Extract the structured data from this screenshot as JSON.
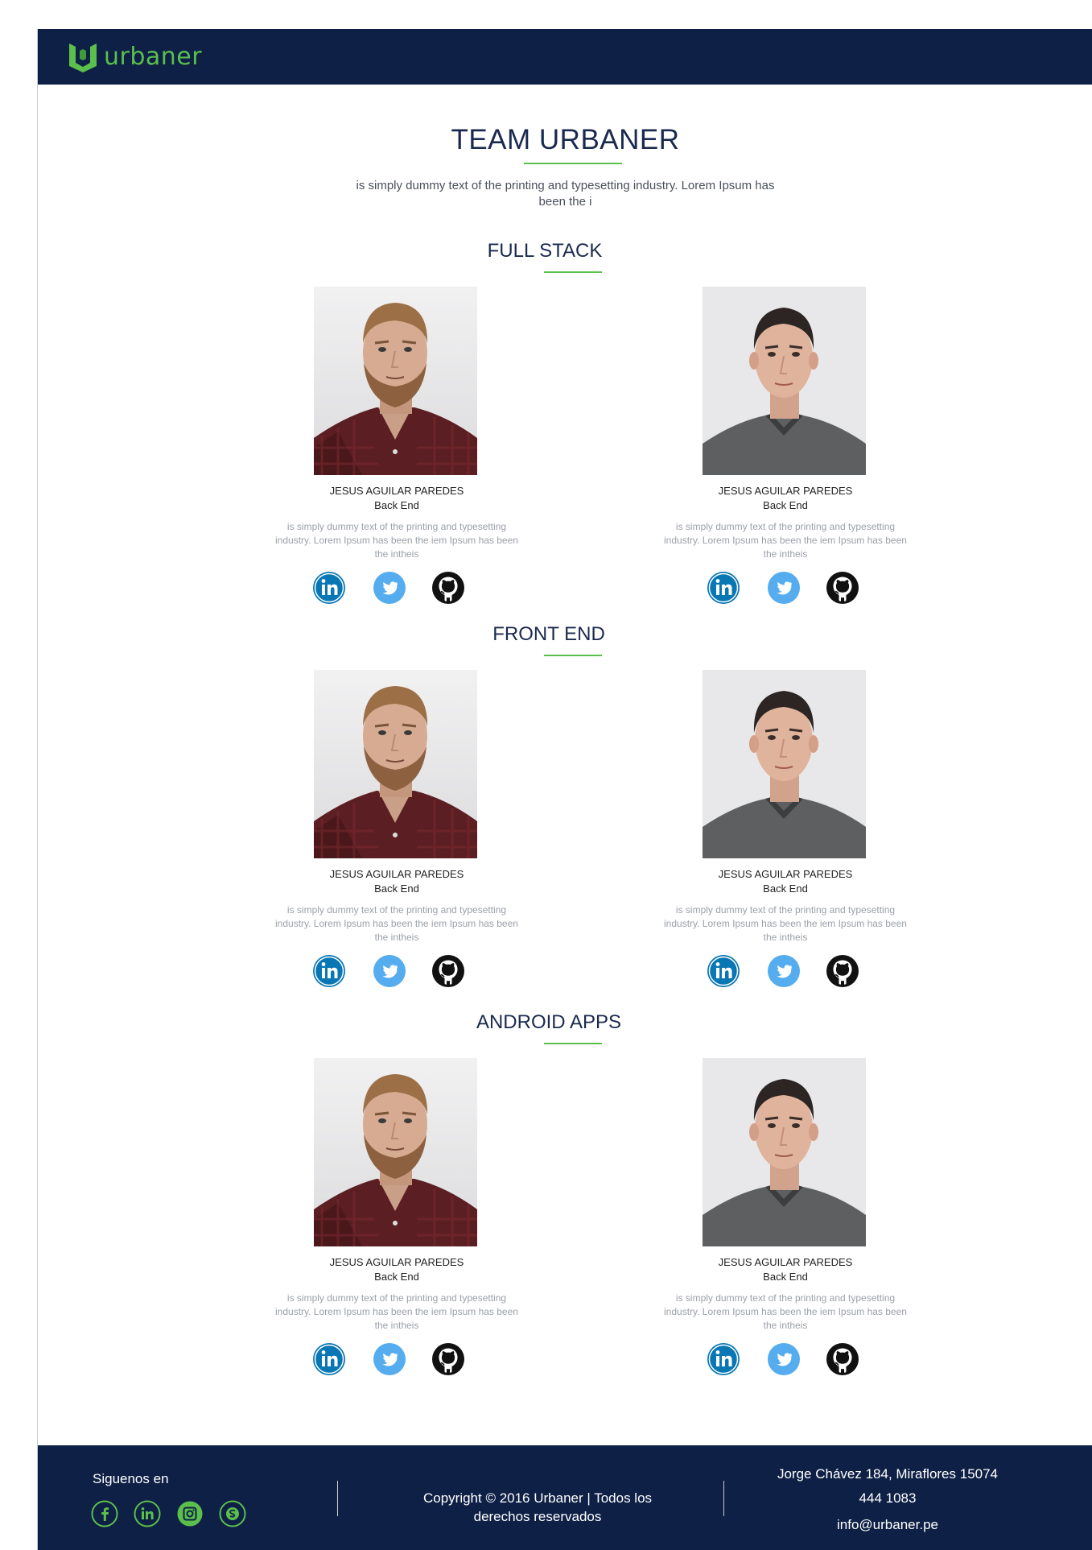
{
  "header": {
    "brand": "urbaner"
  },
  "page": {
    "title": "TEAM URBANER",
    "intro": "is simply dummy text of the printing and typesetting industry. Lorem Ipsum has been the i"
  },
  "sections": [
    {
      "title": "FULL STACK",
      "members": [
        {
          "name": "JESUS AGUILAR PAREDES",
          "role": "Back End",
          "description": "is simply dummy text of the printing and typesetting industry. Lorem Ipsum has been the iem Ipsum has been the intheis"
        },
        {
          "name": "JESUS AGUILAR PAREDES",
          "role": "Back End",
          "description": "is simply dummy text of the printing and typesetting industry. Lorem Ipsum has been the iem Ipsum has been the intheis"
        }
      ]
    },
    {
      "title": "FRONT END",
      "members": [
        {
          "name": "JESUS AGUILAR PAREDES",
          "role": "Back End",
          "description": "is simply dummy text of the printing and typesetting industry. Lorem Ipsum has been the iem Ipsum has been the intheis"
        },
        {
          "name": "JESUS AGUILAR PAREDES",
          "role": "Back End",
          "description": "is simply dummy text of the printing and typesetting industry. Lorem Ipsum has been the iem Ipsum has been the intheis"
        }
      ]
    },
    {
      "title": "ANDROID APPS",
      "members": [
        {
          "name": "JESUS AGUILAR PAREDES",
          "role": "Back End",
          "description": "is simply dummy text of the printing and typesetting industry. Lorem Ipsum has been the iem Ipsum has been the intheis"
        },
        {
          "name": "JESUS AGUILAR PAREDES",
          "role": "Back End",
          "description": "is simply dummy text of the printing and typesetting industry. Lorem Ipsum has been the iem Ipsum has been the intheis"
        }
      ]
    }
  ],
  "member_socials": [
    "linkedin-icon",
    "twitter-icon",
    "github-icon"
  ],
  "footer": {
    "follow_label": "Siguenos en",
    "socials": [
      "facebook-icon",
      "linkedin-icon",
      "instagram-icon",
      "skype-icon"
    ],
    "copyright": "Copyright © 2016 Urbaner | Todos los derechos reservados",
    "address": "Jorge Chávez 184, Miraflores 15074",
    "phone": "444 1083",
    "email": "info@urbaner.pe"
  },
  "colors": {
    "navy": "#0e2046",
    "green": "#5bbf4c",
    "linkedin": "#0a77b5",
    "twitter": "#55acee"
  }
}
